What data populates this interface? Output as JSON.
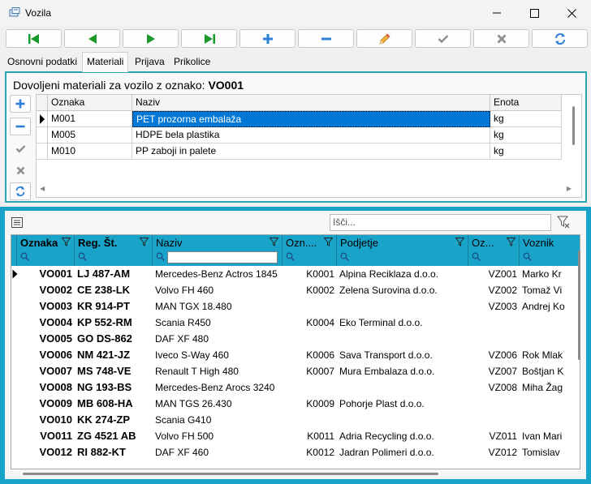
{
  "window": {
    "title": "Vozila",
    "icon": "app-icon",
    "controls": [
      "minimize-icon",
      "maximize-icon",
      "close-icon"
    ]
  },
  "toolbar": {
    "buttons": [
      {
        "name": "first-record",
        "icon": "skip-first-icon",
        "color": "#1a9a2a"
      },
      {
        "name": "prev-record",
        "icon": "arrow-left-icon",
        "color": "#1a9a2a"
      },
      {
        "name": "next-record",
        "icon": "arrow-right-icon",
        "color": "#1a9a2a"
      },
      {
        "name": "last-record",
        "icon": "skip-last-icon",
        "color": "#1a9a2a"
      },
      {
        "name": "add-record",
        "icon": "plus-icon",
        "color": "#2f7fd6"
      },
      {
        "name": "delete-record",
        "icon": "minus-icon",
        "color": "#2f7fd6"
      },
      {
        "name": "edit-record",
        "icon": "pencil-icon",
        "color": "#e4a423"
      },
      {
        "name": "confirm",
        "icon": "check-icon",
        "color": "#9a9a9a"
      },
      {
        "name": "cancel",
        "icon": "x-icon",
        "color": "#9a9a9a"
      },
      {
        "name": "refresh",
        "icon": "refresh-icon",
        "color": "#2f7fd6"
      }
    ]
  },
  "tabs": [
    {
      "label": "Osnovni podatki",
      "active": false
    },
    {
      "label": "Materiali",
      "active": true
    },
    {
      "label": "Prijava",
      "active": false
    },
    {
      "label": "Prikolice",
      "active": false
    }
  ],
  "materials": {
    "caption_prefix": "Dovoljeni materiali za vozilo z oznako:",
    "caption_code": "VO001",
    "columns": [
      "Oznaka",
      "Naziv",
      "Enota"
    ],
    "rows": [
      {
        "oznaka": "M001",
        "naziv": "PET prozorna embalaža",
        "enota": "kg",
        "current": true
      },
      {
        "oznaka": "M005",
        "naziv": "HDPE bela plastika",
        "enota": "kg",
        "current": false
      },
      {
        "oznaka": "M010",
        "naziv": "PP zaboji in palete",
        "enota": "kg",
        "current": false
      }
    ]
  },
  "vehicles": {
    "search_placeholder": "Išči...",
    "columns": [
      "Oznaka",
      "Reg. Št.",
      "Naziv",
      "Ozn....",
      "Podjetje",
      "Oz...",
      "Voznik"
    ],
    "rows": [
      {
        "oznaka": "VO001",
        "reg": "LJ 487-AM",
        "naziv": "Mercedes-Benz Actros 1845",
        "ozn": "K0001",
        "podjetje": "Alpina Reciklaza d.o.o.",
        "oz": "VZ001",
        "voznik": "Marko Kr"
      },
      {
        "oznaka": "VO002",
        "reg": "CE 238-LK",
        "naziv": "Volvo FH 460",
        "ozn": "K0002",
        "podjetje": "Zelena Surovina d.o.o.",
        "oz": "VZ002",
        "voznik": "Tomaž Vi"
      },
      {
        "oznaka": "VO003",
        "reg": "KR 914-PT",
        "naziv": "MAN TGX 18.480",
        "ozn": "",
        "podjetje": "",
        "oz": "VZ003",
        "voznik": "Andrej Ko"
      },
      {
        "oznaka": "VO004",
        "reg": "KP 552-RM",
        "naziv": "Scania R450",
        "ozn": "K0004",
        "podjetje": "Eko Terminal d.o.o.",
        "oz": "",
        "voznik": ""
      },
      {
        "oznaka": "VO005",
        "reg": "GO DS-862",
        "naziv": "DAF XF 480",
        "ozn": "",
        "podjetje": "",
        "oz": "",
        "voznik": ""
      },
      {
        "oznaka": "VO006",
        "reg": "NM 421-JZ",
        "naziv": "Iveco S-Way 460",
        "ozn": "K0006",
        "podjetje": "Sava Transport d.o.o.",
        "oz": "VZ006",
        "voznik": "Rok Mlak"
      },
      {
        "oznaka": "VO007",
        "reg": "MS 748-VE",
        "naziv": "Renault T High 480",
        "ozn": "K0007",
        "podjetje": "Mura Embalaza d.o.o.",
        "oz": "VZ007",
        "voznik": "Boštjan K"
      },
      {
        "oznaka": "VO008",
        "reg": "NG 193-BS",
        "naziv": "Mercedes-Benz Arocs 3240",
        "ozn": "",
        "podjetje": "",
        "oz": "VZ008",
        "voznik": "Miha Žag"
      },
      {
        "oznaka": "VO009",
        "reg": "MB 608-HA",
        "naziv": "MAN TGS 26.430",
        "ozn": "K0009",
        "podjetje": "Pohorje Plast d.o.o.",
        "oz": "",
        "voznik": ""
      },
      {
        "oznaka": "VO010",
        "reg": "KK 274-ZP",
        "naziv": "Scania G410",
        "ozn": "",
        "podjetje": "",
        "oz": "",
        "voznik": ""
      },
      {
        "oznaka": "VO011",
        "reg": "ZG 4521 AB",
        "naziv": "Volvo FH 500",
        "ozn": "K0011",
        "podjetje": "Adria Recycling d.o.o.",
        "oz": "VZ011",
        "voznik": "Ivan Mari"
      },
      {
        "oznaka": "VO012",
        "reg": "RI 882-KT",
        "naziv": "DAF XF 460",
        "ozn": "K0012",
        "podjetje": "Jadran Polimeri d.o.o.",
        "oz": "VZ012",
        "voznik": "Tomislav"
      }
    ]
  },
  "colors": {
    "accent": "#1aa3c8",
    "panel_border": "#2ba5b0",
    "selection": "#0078d7"
  }
}
